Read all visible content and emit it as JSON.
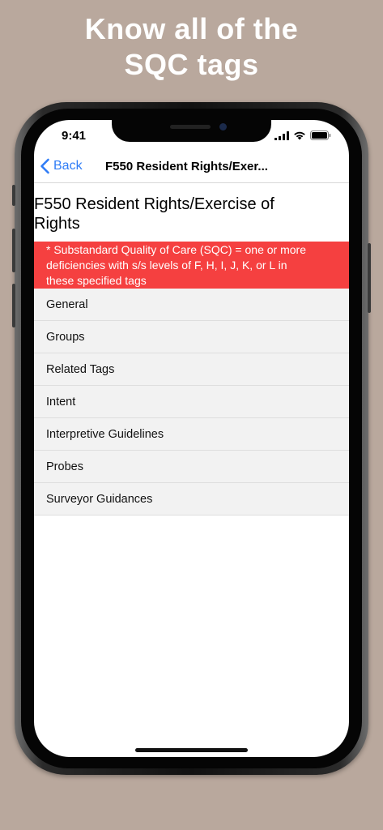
{
  "headline": {
    "line1": "Know all of the",
    "line2": "SQC tags"
  },
  "status_bar": {
    "time": "9:41",
    "icons": [
      "signal-icon",
      "wifi-icon",
      "battery-icon"
    ]
  },
  "nav": {
    "back_label": "Back",
    "title": "F550 Resident Rights/Exer..."
  },
  "page": {
    "title_line1": "F550 Resident Rights/Exercise of",
    "title_line2": "Rights"
  },
  "sqc_banner": {
    "line1": "* Substandard Quality of Care (SQC) = one or more",
    "line2": "deficiencies with s/s levels of F, H, I, J, K, or L in",
    "line3": "these specified tags",
    "color": "#f54040"
  },
  "menu": {
    "items": [
      {
        "label": "General"
      },
      {
        "label": "Groups"
      },
      {
        "label": "Related Tags"
      },
      {
        "label": "Intent"
      },
      {
        "label": "Interpretive Guidelines"
      },
      {
        "label": "Probes"
      },
      {
        "label": "Surveyor Guidances"
      }
    ]
  },
  "colors": {
    "background": "#b9a89d",
    "link": "#2f7cf6"
  }
}
